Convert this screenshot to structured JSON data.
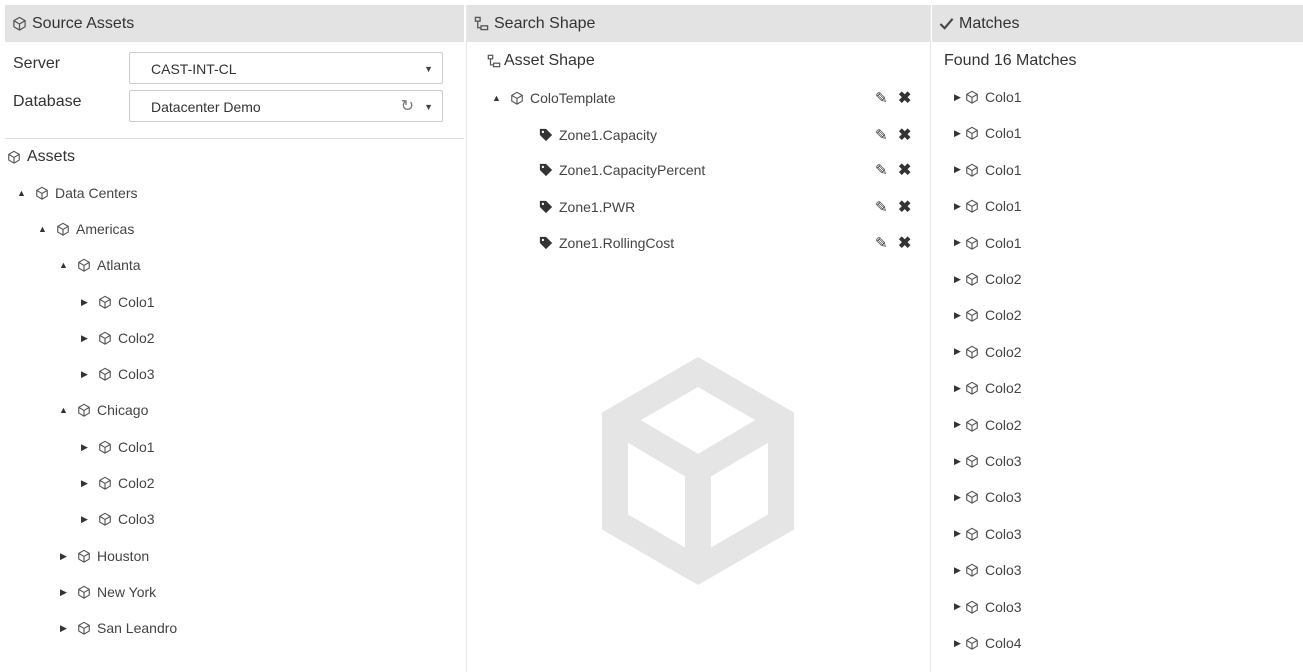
{
  "source_panel": {
    "title": "Source Assets",
    "server_label": "Server",
    "server_value": "CAST-INT-CL",
    "database_label": "Database",
    "database_value": "Datacenter Demo",
    "assets_label": "Assets",
    "tree": {
      "root": "Data Centers",
      "region": "Americas",
      "atlanta": {
        "label": "Atlanta",
        "children": [
          "Colo1",
          "Colo2",
          "Colo3"
        ]
      },
      "chicago": {
        "label": "Chicago",
        "children": [
          "Colo1",
          "Colo2",
          "Colo3"
        ]
      },
      "collapsed": [
        "Houston",
        "New York",
        "San Leandro"
      ]
    }
  },
  "search_panel": {
    "title": "Search Shape",
    "asset_shape_label": "Asset Shape",
    "template": "ColoTemplate",
    "attributes": [
      "Zone1.Capacity",
      "Zone1.CapacityPercent",
      "Zone1.PWR",
      "Zone1.RollingCost"
    ]
  },
  "matches_panel": {
    "title": "Matches",
    "found_text": "Found 16 Matches",
    "items": [
      "Colo1",
      "Colo1",
      "Colo1",
      "Colo1",
      "Colo1",
      "Colo2",
      "Colo2",
      "Colo2",
      "Colo2",
      "Colo2",
      "Colo3",
      "Colo3",
      "Colo3",
      "Colo3",
      "Colo3",
      "Colo4"
    ]
  },
  "colors": {
    "header_bg": "#e3e3e3",
    "text": "#333333",
    "icon": "#555555",
    "watermark": "#e5e5e5"
  },
  "icons": [
    "cube-icon",
    "hierarchy-icon",
    "check-icon",
    "tag-icon",
    "pencil-icon",
    "close-icon",
    "refresh-icon",
    "caret-down-icon",
    "triangle-expanded-icon",
    "triangle-collapsed-icon"
  ]
}
